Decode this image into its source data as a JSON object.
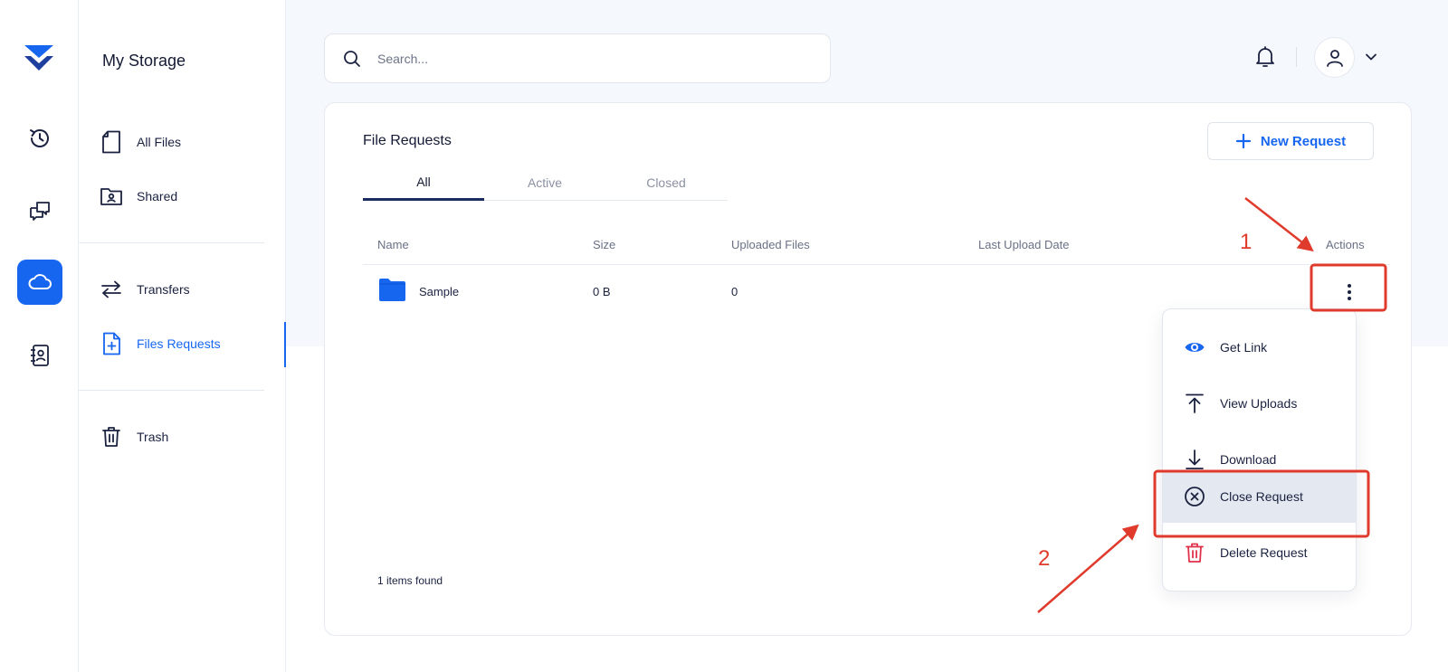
{
  "sidebar": {
    "title": "My Storage",
    "items": [
      {
        "label": "All Files"
      },
      {
        "label": "Shared"
      },
      {
        "label": "Transfers"
      },
      {
        "label": "Files Requests"
      },
      {
        "label": "Trash"
      }
    ],
    "active_item": "Files Requests"
  },
  "rail": {
    "icons": [
      "logo-icon",
      "history-icon",
      "chat-icon",
      "cloud-icon",
      "contacts-icon"
    ],
    "active": "cloud-icon"
  },
  "header": {
    "search_placeholder": "Search..."
  },
  "card": {
    "title": "File Requests",
    "new_button": "New Request",
    "tabs": [
      {
        "label": "All",
        "active": true
      },
      {
        "label": "Active",
        "active": false
      },
      {
        "label": "Closed",
        "active": false
      }
    ],
    "columns": [
      "Name",
      "Size",
      "Uploaded Files",
      "Last Upload Date",
      "Actions"
    ],
    "rows": [
      {
        "name": "Sample",
        "size": "0 B",
        "uploaded": "0",
        "last_upload": ""
      }
    ],
    "footer": "1 items found"
  },
  "menu": {
    "items": [
      {
        "label": "Get Link",
        "icon": "eye-icon"
      },
      {
        "label": "View Uploads",
        "icon": "upload-icon"
      },
      {
        "label": "Download",
        "icon": "download-icon"
      },
      {
        "label": "Close Request",
        "icon": "close-circle-icon",
        "highlighted": true
      },
      {
        "label": "Delete Request",
        "icon": "trash-icon"
      }
    ]
  },
  "annotations": {
    "step1": "1",
    "step2": "2"
  },
  "colors": {
    "accent": "#1766f0",
    "annotation": "#e03a2c",
    "danger": "#e0324a"
  }
}
